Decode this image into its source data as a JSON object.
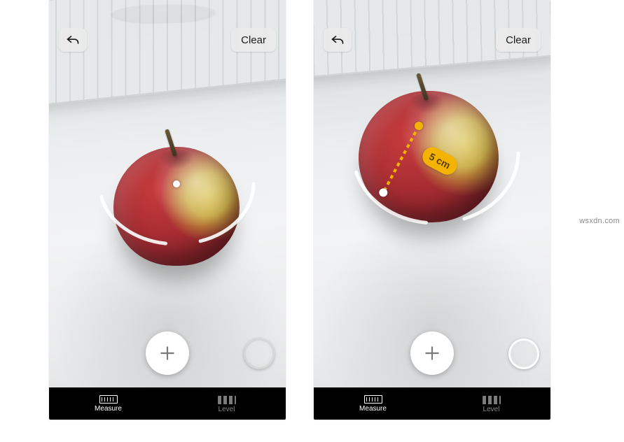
{
  "watermark": "wsxdn.com",
  "buttons": {
    "undo_aria": "Undo",
    "clear_label": "Clear",
    "add_aria": "Add point",
    "shutter_aria": "Capture"
  },
  "tabs": {
    "measure": "Measure",
    "level": "Level"
  },
  "measurement": {
    "value_label": "5 cm"
  },
  "icons": {
    "undo": "undo-arrow-icon",
    "plus": "plus-icon",
    "ruler": "ruler-icon",
    "level": "level-icon",
    "shutter": "shutter-icon"
  }
}
